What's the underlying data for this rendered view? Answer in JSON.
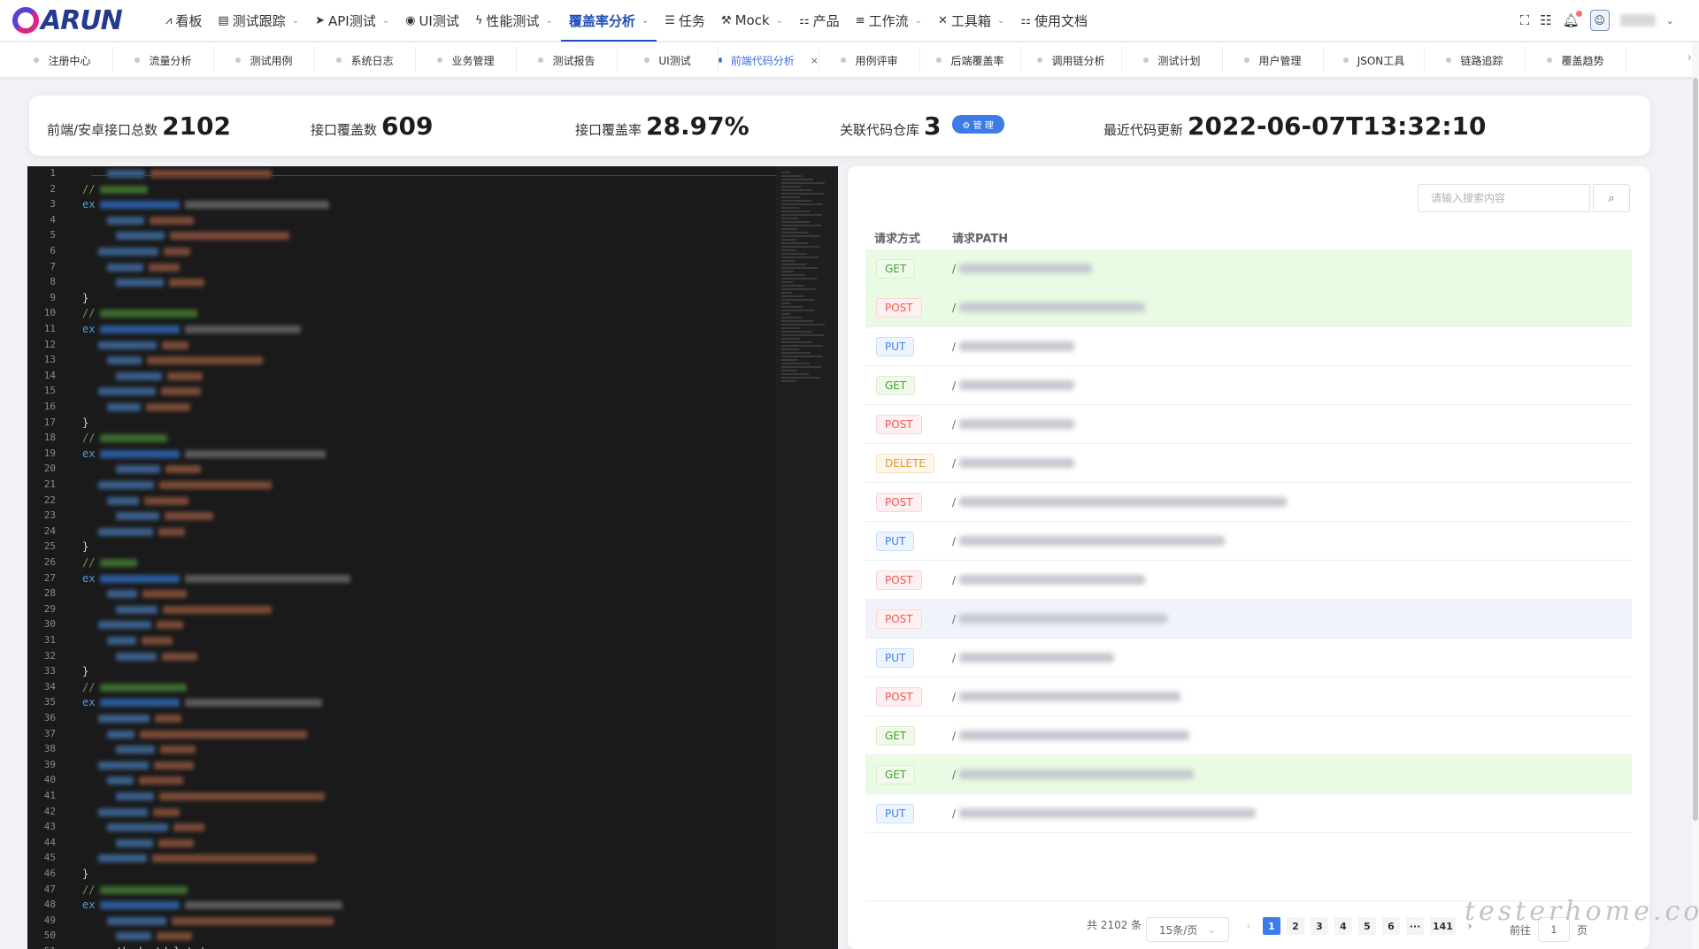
{
  "brand": {
    "name": "ARUN"
  },
  "nav": {
    "items": [
      {
        "label": "看板",
        "icon": "chart-line-icon",
        "glyph": "⩘",
        "caret": false,
        "active": false
      },
      {
        "label": "测试跟踪",
        "icon": "document-icon",
        "glyph": "▤",
        "caret": true,
        "active": false
      },
      {
        "label": "API测试",
        "icon": "send-icon",
        "glyph": "➤",
        "caret": true,
        "active": false
      },
      {
        "label": "UI测试",
        "icon": "compass-icon",
        "glyph": "◉",
        "caret": false,
        "active": false
      },
      {
        "label": "性能测试",
        "icon": "lightning-icon",
        "glyph": "ϟ",
        "caret": true,
        "active": false
      },
      {
        "label": "覆盖率分析",
        "icon": "",
        "glyph": "",
        "caret": true,
        "active": true
      },
      {
        "label": "任务",
        "icon": "list-icon",
        "glyph": "☰",
        "caret": false,
        "active": false
      },
      {
        "label": "Mock",
        "icon": "magic-wand-icon",
        "glyph": "⚒",
        "caret": true,
        "active": false
      },
      {
        "label": "产品",
        "icon": "flow-icon",
        "glyph": "⚏",
        "caret": false,
        "active": false
      },
      {
        "label": "工作流",
        "icon": "workflow-icon",
        "glyph": "≡",
        "caret": true,
        "active": false
      },
      {
        "label": "工具箱",
        "icon": "tools-icon",
        "glyph": "✕",
        "caret": true,
        "active": false
      },
      {
        "label": "使用文档",
        "icon": "docs-icon",
        "glyph": "⚏",
        "caret": false,
        "active": false
      }
    ]
  },
  "tabs": [
    {
      "label": "注册中心",
      "active": false
    },
    {
      "label": "流量分析",
      "active": false
    },
    {
      "label": "测试用例",
      "active": false
    },
    {
      "label": "系统日志",
      "active": false
    },
    {
      "label": "业务管理",
      "active": false
    },
    {
      "label": "测试报告",
      "active": false
    },
    {
      "label": "UI测试",
      "active": false
    },
    {
      "label": "前端代码分析",
      "active": true
    },
    {
      "label": "用例评审",
      "active": false
    },
    {
      "label": "后端覆盖率",
      "active": false
    },
    {
      "label": "调用链分析",
      "active": false
    },
    {
      "label": "测试计划",
      "active": false
    },
    {
      "label": "用户管理",
      "active": false
    },
    {
      "label": "JSON工具",
      "active": false
    },
    {
      "label": "链路追踪",
      "active": false
    },
    {
      "label": "覆盖趋势",
      "active": false
    }
  ],
  "stats": {
    "total_label": "前端/安卓接口总数",
    "total_value": "2102",
    "covered_label": "接口覆盖数",
    "covered_value": "609",
    "rate_label": "接口覆盖率",
    "rate_value": "28.97%",
    "repo_label": "关联代码仓库",
    "repo_value": "3",
    "repo_badge": "⚙ 管 理",
    "update_label": "最近代码更新",
    "update_value": "2022-06-07T13:32:10"
  },
  "editor": {
    "line_count": 51,
    "last_line_text": "method: 'delete'"
  },
  "table": {
    "search_placeholder": "请输入搜索内容",
    "col_method": "请求方式",
    "col_path": "请求PATH",
    "rows": [
      {
        "method": "GET",
        "highlight": true
      },
      {
        "method": "POST",
        "highlight": true
      },
      {
        "method": "PUT",
        "highlight": false
      },
      {
        "method": "GET",
        "highlight": false
      },
      {
        "method": "POST",
        "highlight": false
      },
      {
        "method": "DELETE",
        "highlight": false
      },
      {
        "method": "POST",
        "highlight": false
      },
      {
        "method": "PUT",
        "highlight": false
      },
      {
        "method": "POST",
        "highlight": false
      },
      {
        "method": "POST",
        "highlight": false
      },
      {
        "method": "PUT",
        "highlight": false
      },
      {
        "method": "POST",
        "highlight": false
      },
      {
        "method": "GET",
        "highlight": false
      },
      {
        "method": "GET",
        "highlight": true
      },
      {
        "method": "PUT",
        "highlight": false
      }
    ]
  },
  "pager": {
    "total_text": "共 2102 条",
    "page_size": "15条/页",
    "pages": [
      "1",
      "2",
      "3",
      "4",
      "5",
      "6",
      "···",
      "141"
    ],
    "current_page": "1",
    "goto_label": "前往",
    "goto_value": "1",
    "page_unit": "页"
  },
  "watermark": "testerhome.com",
  "colors": {
    "accent": "#3c7be8",
    "nav_active": "#1f4fb8",
    "covered_row": "#eafbe3",
    "editor_bg": "#1a1a1a"
  }
}
